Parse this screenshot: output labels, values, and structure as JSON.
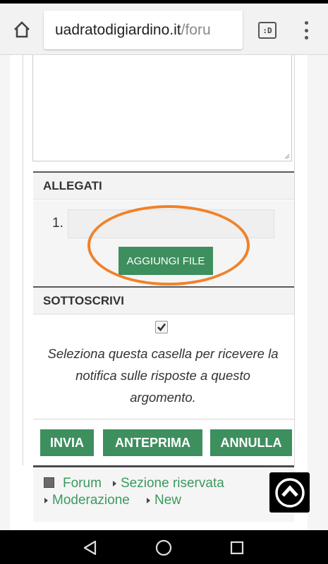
{
  "browser": {
    "url_host": "uadratodigiardino.it",
    "url_path": "/foru",
    "tabs_label": ":D"
  },
  "attachments": {
    "header": "ALLEGATI",
    "slot_number": "1.",
    "add_button": "AGGIUNGI FILE"
  },
  "subscribe": {
    "header": "SOTTOSCRIVI",
    "checked": true,
    "description": "Seleziona questa casella per ricevere la notifica sulle risposte a questo argomento."
  },
  "actions": {
    "submit": "INVIA",
    "preview": "ANTEPRIMA",
    "cancel": "ANNULLA"
  },
  "breadcrumb": {
    "items": [
      "Forum",
      "Sezione riservata",
      "Moderazione",
      "New"
    ]
  },
  "colors": {
    "accent_green": "#3e8f5e",
    "link_green": "#3a9a5e",
    "highlight_orange": "#f0822a"
  },
  "icons": {
    "home": "home-icon",
    "menu": "more-vert-icon",
    "scroll_top": "arrow-up-circle-icon",
    "nav_back": "triangle-back-icon",
    "nav_home": "circle-home-icon",
    "nav_recents": "square-recents-icon"
  }
}
